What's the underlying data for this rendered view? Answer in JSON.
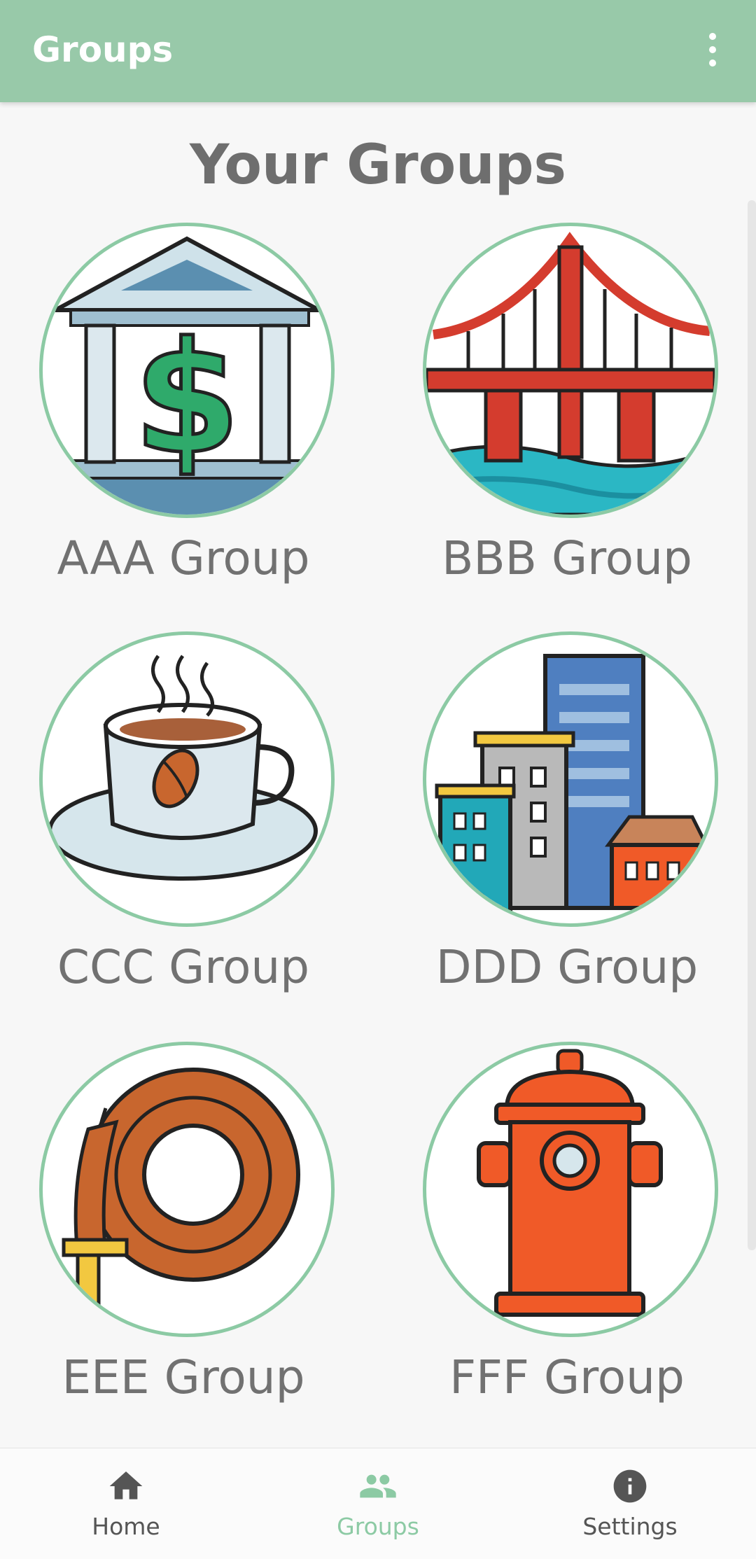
{
  "app_bar": {
    "title": "Groups",
    "overflow_icon": "more-vert-icon"
  },
  "page_title": "Your Groups",
  "groups": [
    {
      "label": "AAA Group",
      "icon": "bank-icon"
    },
    {
      "label": "BBB Group",
      "icon": "bridge-icon"
    },
    {
      "label": "CCC Group",
      "icon": "coffee-cup-icon"
    },
    {
      "label": "DDD Group",
      "icon": "city-buildings-icon"
    },
    {
      "label": "EEE Group",
      "icon": "hose-icon"
    },
    {
      "label": "FFF Group",
      "icon": "fire-hydrant-icon"
    }
  ],
  "bottom_nav": {
    "items": [
      {
        "label": "Home",
        "icon": "home-icon",
        "active": false
      },
      {
        "label": "Groups",
        "icon": "groups-icon",
        "active": true
      },
      {
        "label": "Settings",
        "icon": "info-icon",
        "active": false
      }
    ]
  },
  "colors": {
    "app_bar": "#98c9a9",
    "accent": "#8ccaa4",
    "background": "#f7f7f7",
    "text_gray": "#717171"
  }
}
